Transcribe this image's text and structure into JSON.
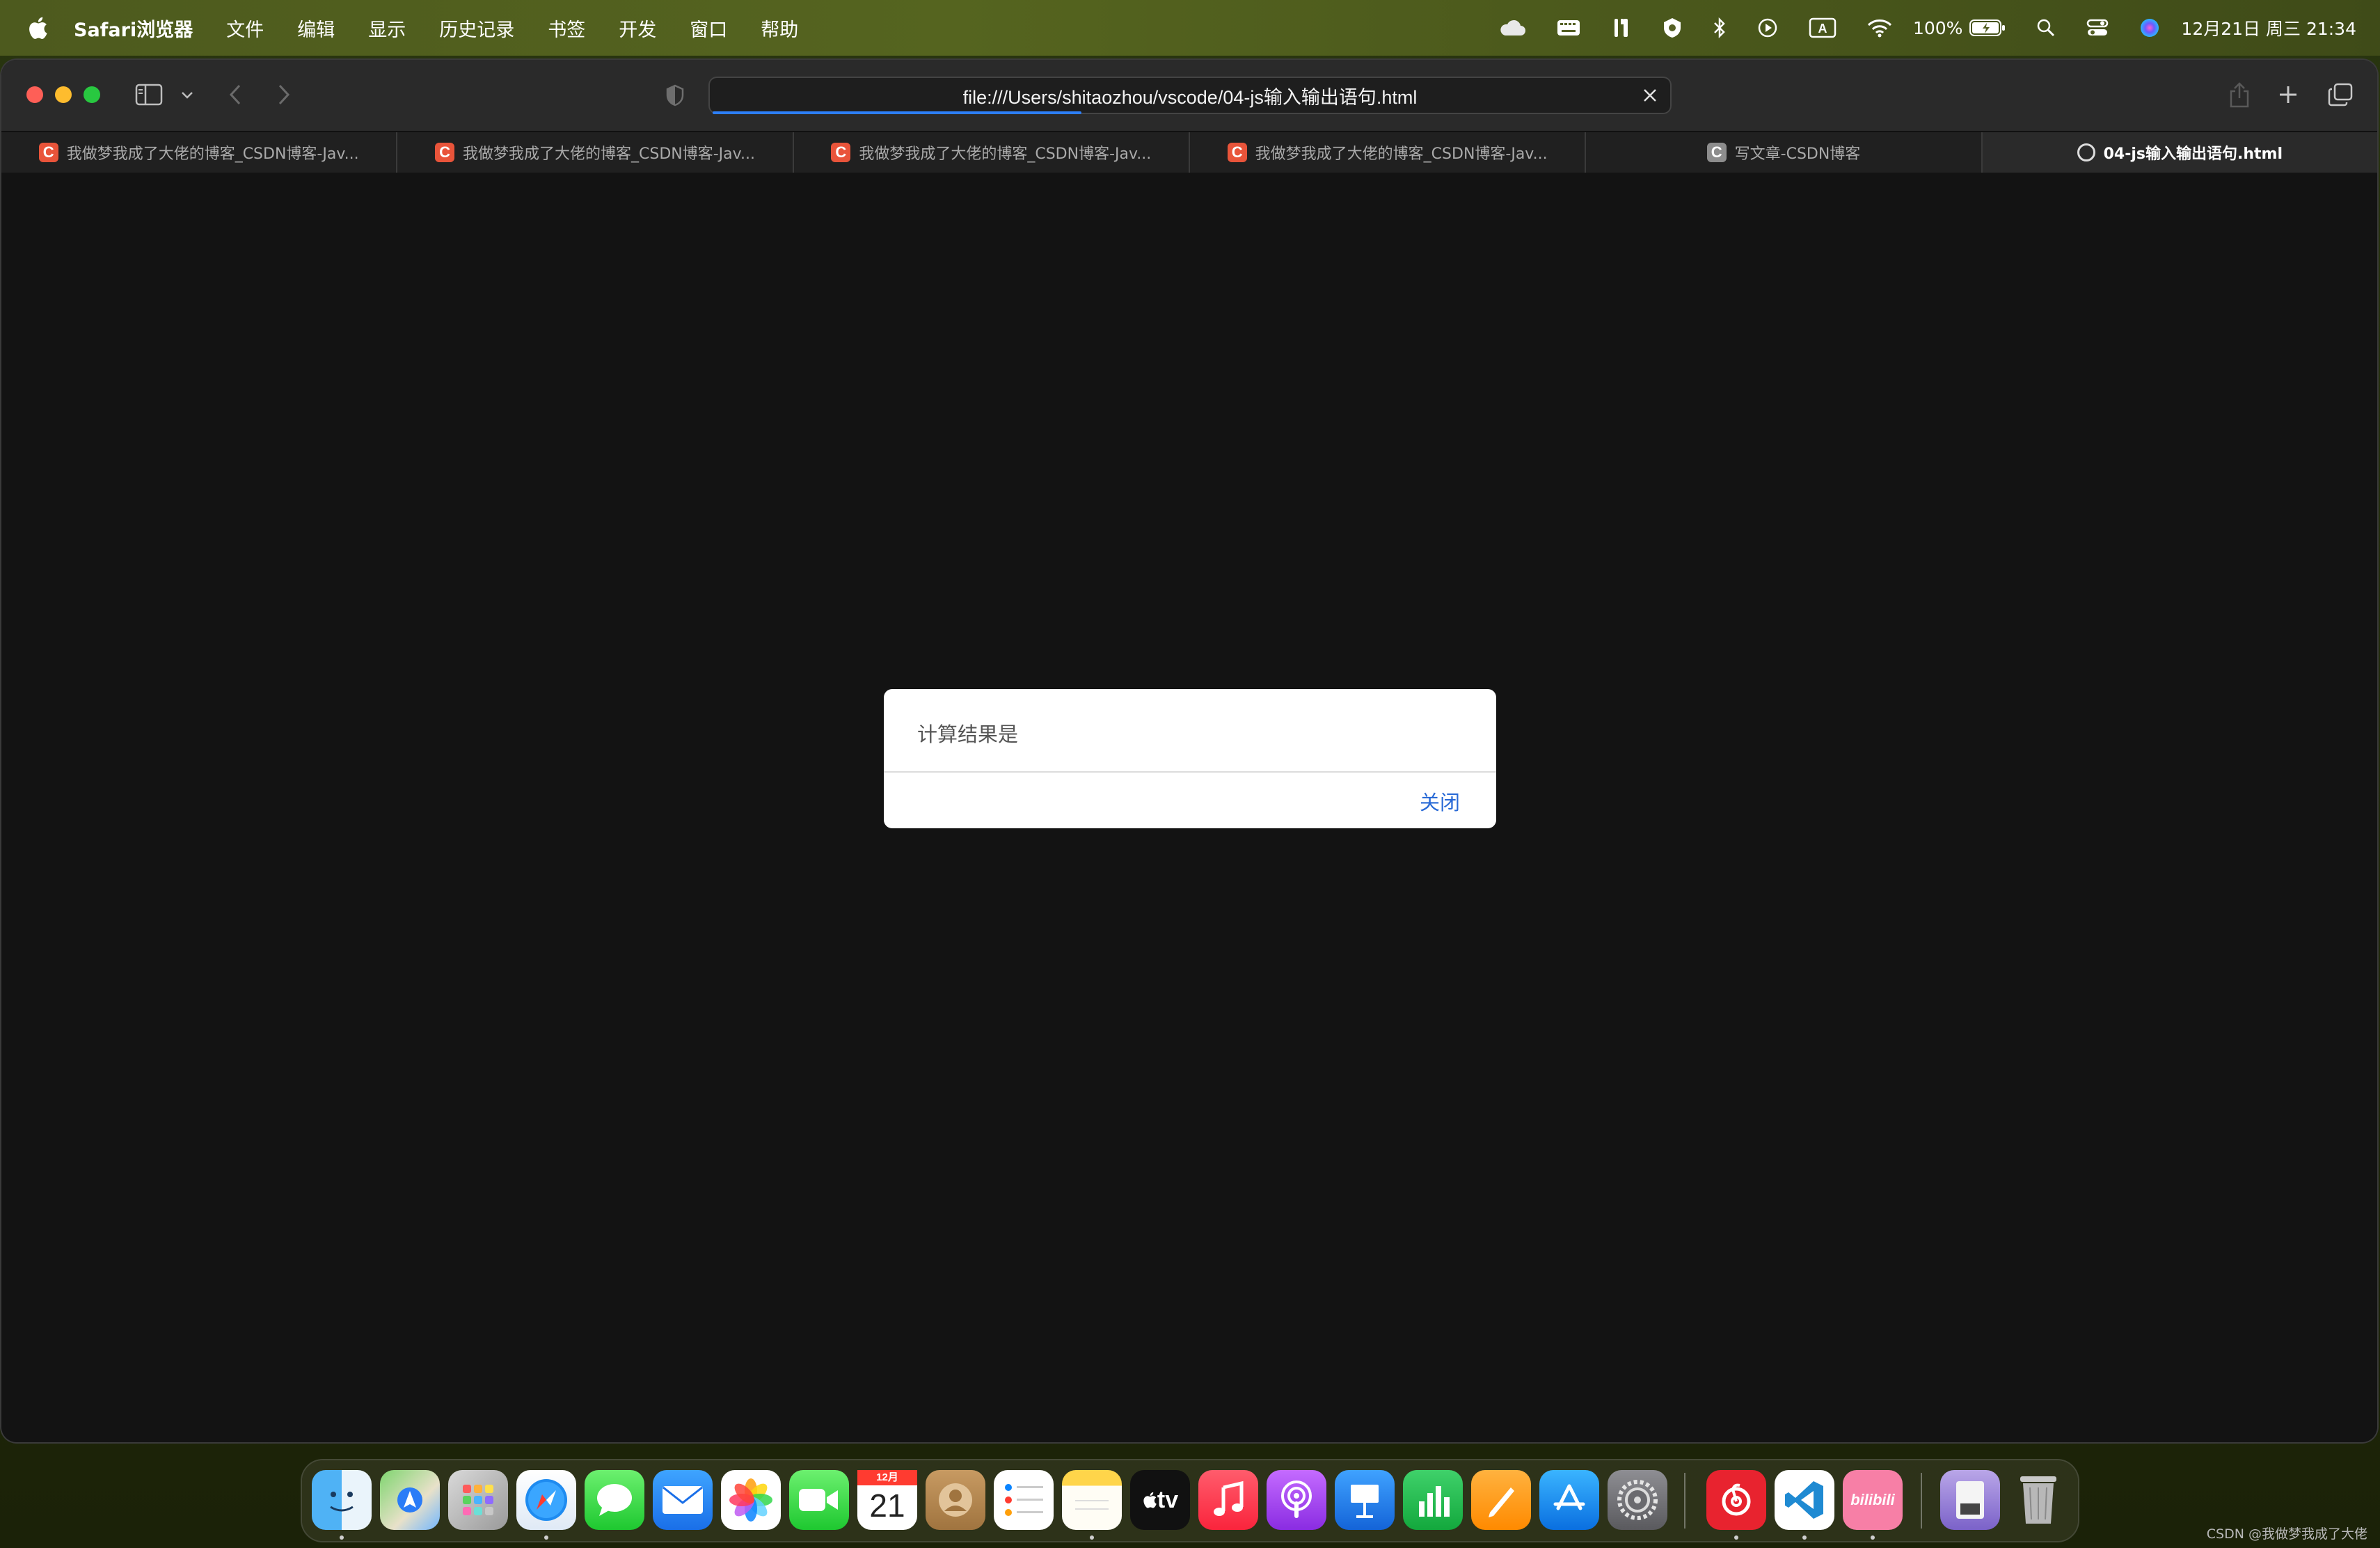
{
  "menubar": {
    "app_name": "Safari浏览器",
    "items": [
      "文件",
      "编辑",
      "显示",
      "历史记录",
      "书签",
      "开发",
      "窗口",
      "帮助"
    ],
    "battery": "100%",
    "datetime": "12月21日 周三  21:34"
  },
  "browser": {
    "url": "file:///Users/shitaozhou/vscode/04-js输入输出语句.html",
    "tabs": [
      {
        "title": "我做梦我成了大佬的博客_CSDN博客-Jav...",
        "favicon": "C"
      },
      {
        "title": "我做梦我成了大佬的博客_CSDN博客-Jav...",
        "favicon": "C"
      },
      {
        "title": "我做梦我成了大佬的博客_CSDN博客-Jav...",
        "favicon": "C"
      },
      {
        "title": "我做梦我成了大佬的博客_CSDN博客-Jav...",
        "favicon": "C"
      },
      {
        "title": "写文章-CSDN博客",
        "favicon": "C"
      },
      {
        "title": "04-js输入输出语句.html",
        "favicon": ""
      }
    ]
  },
  "dialog": {
    "message": "计算结果是",
    "close_label": "关闭"
  },
  "dock": {
    "calendar_month": "12月",
    "calendar_day": "21",
    "tv_label": "tv",
    "bilibili_label": "bilibili"
  },
  "watermark": "CSDN @我做梦我成了大佬",
  "colors": {
    "accent": "#2869d6",
    "progress": "#2d7ff9",
    "csdn": "#e9543a"
  }
}
